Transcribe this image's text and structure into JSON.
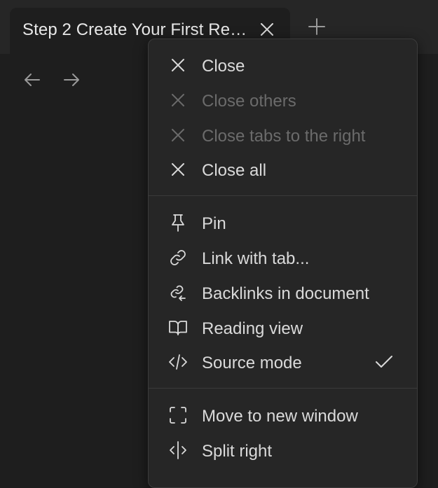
{
  "tab": {
    "title": "Step 2 Create Your First Re…",
    "close_icon": "close-icon",
    "new_tab_icon": "plus-icon"
  },
  "nav": {
    "back_icon": "arrow-left-icon",
    "forward_icon": "arrow-right-icon"
  },
  "menu": {
    "group1": [
      {
        "label": "Close",
        "icon": "close-icon",
        "disabled": false
      },
      {
        "label": "Close others",
        "icon": "close-icon",
        "disabled": true
      },
      {
        "label": "Close tabs to the right",
        "icon": "close-icon",
        "disabled": true
      },
      {
        "label": "Close all",
        "icon": "close-icon",
        "disabled": false
      }
    ],
    "group2": [
      {
        "label": "Pin",
        "icon": "pin-icon"
      },
      {
        "label": "Link with tab...",
        "icon": "link-icon"
      },
      {
        "label": "Backlinks in document",
        "icon": "backlinks-icon"
      },
      {
        "label": "Reading view",
        "icon": "book-open-icon"
      },
      {
        "label": "Source mode",
        "icon": "code-icon",
        "checked": true
      }
    ],
    "group3": [
      {
        "label": "Move to new window",
        "icon": "maximize-icon"
      },
      {
        "label": "Split right",
        "icon": "split-icon"
      }
    ]
  },
  "colors": {
    "background": "#1e1e1e",
    "tabbar": "#262626",
    "menu_bg": "#262626",
    "text": "#dadada",
    "disabled_text": "#6b6b6b"
  }
}
